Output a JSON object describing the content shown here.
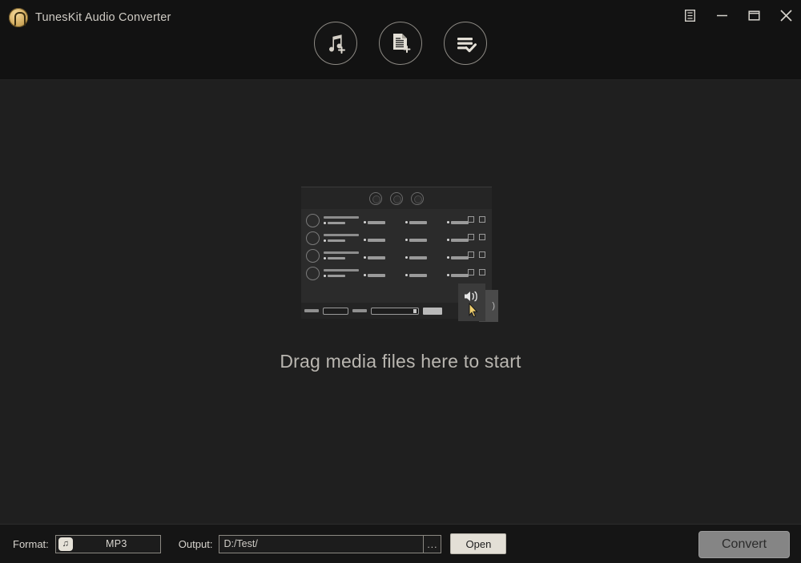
{
  "window": {
    "title": "TunesKit Audio Converter",
    "logo_icon": "tuneskit-logo-icon",
    "controls": [
      {
        "name": "menu-icon",
        "label": ""
      },
      {
        "name": "minimize-icon",
        "label": ""
      },
      {
        "name": "maximize-icon",
        "label": ""
      },
      {
        "name": "close-icon",
        "label": ""
      }
    ]
  },
  "toolbar": {
    "buttons": [
      {
        "name": "add-music-button",
        "icon": "music-note-plus-icon",
        "tooltip": "Add Music"
      },
      {
        "name": "add-file-button",
        "icon": "document-plus-icon",
        "tooltip": "Add File"
      },
      {
        "name": "converted-list-button",
        "icon": "list-check-icon",
        "tooltip": "Converted"
      }
    ]
  },
  "main": {
    "drop_hint": "Drag media files here to start",
    "illustration": {
      "name": "app-window-illustration",
      "top_circles": 3,
      "rows": 4,
      "row_checkboxes_per_row": 2,
      "popup_icon": "speaker-volume-icon",
      "cursor_icon": "mouse-cursor-icon"
    }
  },
  "bottom_bar": {
    "format_label": "Format:",
    "format_value": "MP3",
    "format_icon": "music-note-icon",
    "output_label": "Output:",
    "output_value": "D:/Test/",
    "browse_label": "...",
    "open_label": "Open",
    "convert_label": "Convert"
  },
  "colors": {
    "window_background": "#1f1f1f",
    "header_background": "#121212",
    "bottom_bar_background": "#151515",
    "accent_logo": "#d9b469",
    "text_primary": "#d7d4ce",
    "text_muted": "#b9b6b0",
    "open_button": "#e3dfd6",
    "convert_button_disabled": "#858585"
  }
}
